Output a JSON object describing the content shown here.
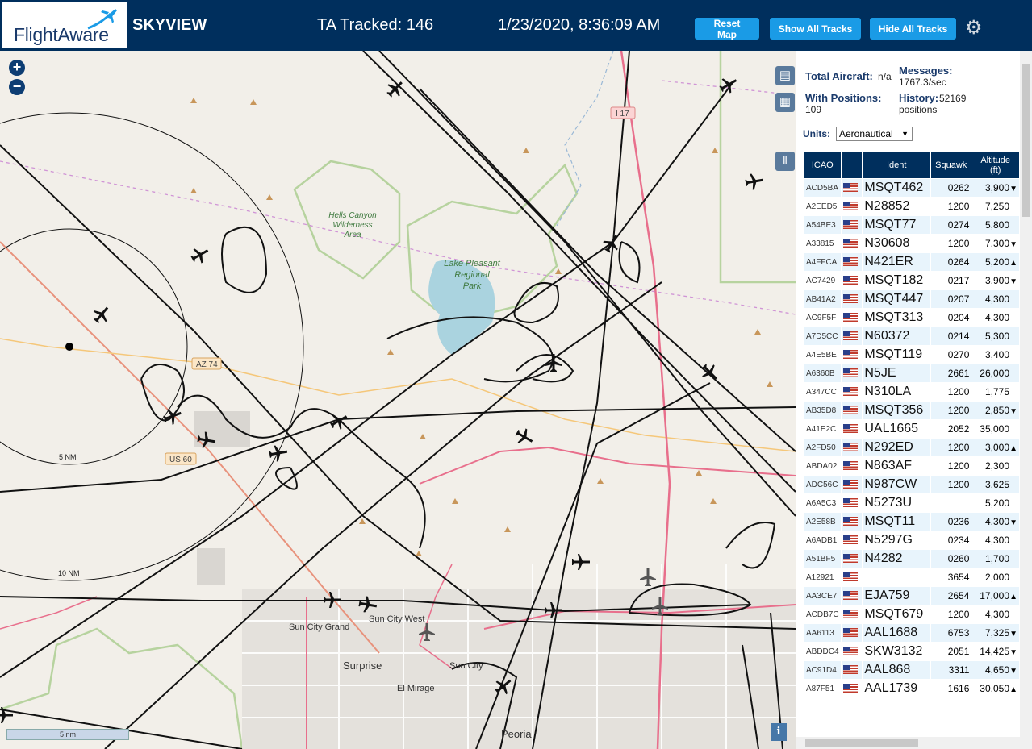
{
  "header": {
    "logo": "FlightAware",
    "app_title": "SKYVIEW",
    "tracked": "TA Tracked: 146",
    "clock": "1/23/2020, 8:36:09 AM",
    "buttons": {
      "reset": "Reset Map",
      "show_all": "Show All Tracks",
      "hide_all": "Hide All Tracks"
    }
  },
  "map": {
    "labels": {
      "hells_canyon": [
        "Hells Canyon",
        "Wilderness",
        "Area"
      ],
      "lake_pleasant": [
        "Lake Pleasant",
        "Regional",
        "Park"
      ],
      "az74": "AZ 74",
      "us60": "US 60",
      "i17": "I 17",
      "sun_city_grand": "Sun City Grand",
      "sun_city_west": "Sun City West",
      "sun_city": "Sun City",
      "surprise": "Surprise",
      "el_mirage": "El Mirage",
      "peoria": "Peoria",
      "ring5": "5 NM",
      "ring10": "10 NM"
    },
    "scale": "5 nm",
    "info": "i"
  },
  "stats": {
    "total_label": "Total Aircraft:",
    "total_value": "n/a",
    "messages_label": "Messages:",
    "messages_value": "1767.3/sec",
    "positions_label": "With Positions:",
    "positions_value": "109",
    "history_label": "History:",
    "history_value": "52169",
    "history_unit": "positions"
  },
  "units": {
    "label": "Units:",
    "selected": "Aeronautical"
  },
  "table": {
    "headers": {
      "icao": "ICAO",
      "ident": "Ident",
      "squawk": "Squawk",
      "altitude": "Altitude",
      "altitude_unit": "(ft)"
    },
    "rows": [
      {
        "icao": "ACD5BA",
        "ident": "MSQT462",
        "squawk": "0262",
        "altitude": "3,900",
        "trend": "▼"
      },
      {
        "icao": "A2EED5",
        "ident": "N28852",
        "squawk": "1200",
        "altitude": "7,250",
        "trend": ""
      },
      {
        "icao": "A54BE3",
        "ident": "MSQT77",
        "squawk": "0274",
        "altitude": "5,800",
        "trend": ""
      },
      {
        "icao": "A33815",
        "ident": "N30608",
        "squawk": "1200",
        "altitude": "7,300",
        "trend": "▼"
      },
      {
        "icao": "A4FFCA",
        "ident": "N421ER",
        "squawk": "0264",
        "altitude": "5,200",
        "trend": "▲"
      },
      {
        "icao": "AC7429",
        "ident": "MSQT182",
        "squawk": "0217",
        "altitude": "3,900",
        "trend": "▼"
      },
      {
        "icao": "AB41A2",
        "ident": "MSQT447",
        "squawk": "0207",
        "altitude": "4,300",
        "trend": ""
      },
      {
        "icao": "AC9F5F",
        "ident": "MSQT313",
        "squawk": "0204",
        "altitude": "4,300",
        "trend": ""
      },
      {
        "icao": "A7D5CC",
        "ident": "N60372",
        "squawk": "0214",
        "altitude": "5,300",
        "trend": ""
      },
      {
        "icao": "A4E5BE",
        "ident": "MSQT119",
        "squawk": "0270",
        "altitude": "3,400",
        "trend": ""
      },
      {
        "icao": "A6360B",
        "ident": "N5JE",
        "squawk": "2661",
        "altitude": "26,000",
        "trend": ""
      },
      {
        "icao": "A347CC",
        "ident": "N310LA",
        "squawk": "1200",
        "altitude": "1,775",
        "trend": ""
      },
      {
        "icao": "AB35D8",
        "ident": "MSQT356",
        "squawk": "1200",
        "altitude": "2,850",
        "trend": "▼"
      },
      {
        "icao": "A41E2C",
        "ident": "UAL1665",
        "squawk": "2052",
        "altitude": "35,000",
        "trend": ""
      },
      {
        "icao": "A2FD50",
        "ident": "N292ED",
        "squawk": "1200",
        "altitude": "3,000",
        "trend": "▲"
      },
      {
        "icao": "ABDA02",
        "ident": "N863AF",
        "squawk": "1200",
        "altitude": "2,300",
        "trend": ""
      },
      {
        "icao": "ADC56C",
        "ident": "N987CW",
        "squawk": "1200",
        "altitude": "3,625",
        "trend": ""
      },
      {
        "icao": "A6A5C3",
        "ident": "N5273U",
        "squawk": "",
        "altitude": "5,200",
        "trend": ""
      },
      {
        "icao": "A2E58B",
        "ident": "MSQT11",
        "squawk": "0236",
        "altitude": "4,300",
        "trend": "▼"
      },
      {
        "icao": "A6ADB1",
        "ident": "N5297G",
        "squawk": "0234",
        "altitude": "4,300",
        "trend": ""
      },
      {
        "icao": "A51BF5",
        "ident": "N4282",
        "squawk": "0260",
        "altitude": "1,700",
        "trend": ""
      },
      {
        "icao": "A12921",
        "ident": "",
        "squawk": "3654",
        "altitude": "2,000",
        "trend": ""
      },
      {
        "icao": "AA3CE7",
        "ident": "EJA759",
        "squawk": "2654",
        "altitude": "17,000",
        "trend": "▲"
      },
      {
        "icao": "ACDB7C",
        "ident": "MSQT679",
        "squawk": "1200",
        "altitude": "4,300",
        "trend": ""
      },
      {
        "icao": "AA6113",
        "ident": "AAL1688",
        "squawk": "6753",
        "altitude": "7,325",
        "trend": "▼"
      },
      {
        "icao": "ABDDC4",
        "ident": "SKW3132",
        "squawk": "2051",
        "altitude": "14,425",
        "trend": "▼"
      },
      {
        "icao": "AC91D4",
        "ident": "AAL868",
        "squawk": "3311",
        "altitude": "4,650",
        "trend": "▼"
      },
      {
        "icao": "A87F51",
        "ident": "AAL1739",
        "squawk": "1616",
        "altitude": "30,050",
        "trend": "▲"
      }
    ]
  }
}
